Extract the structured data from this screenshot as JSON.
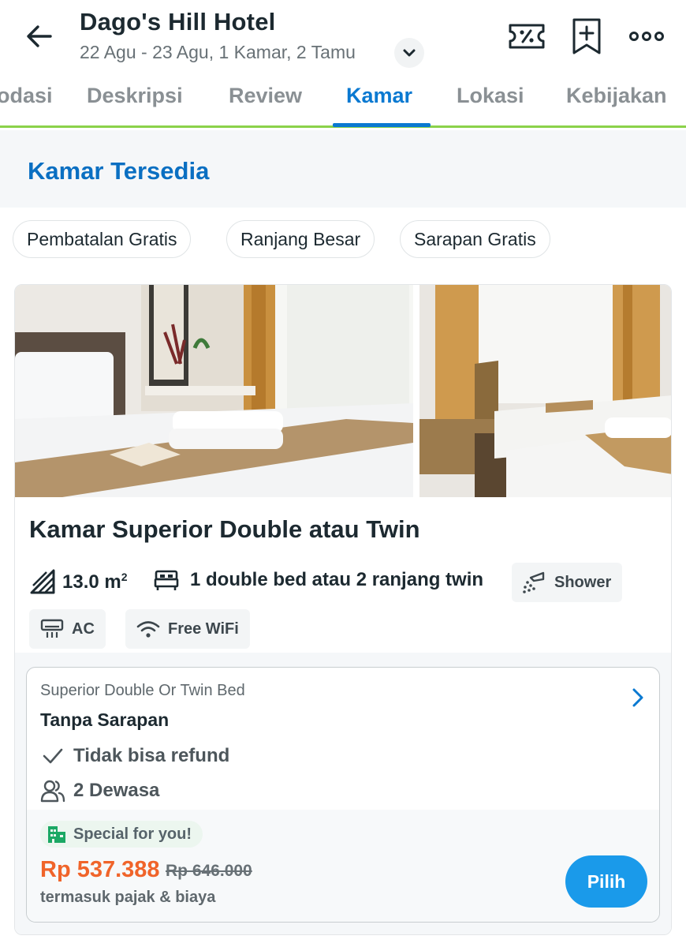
{
  "header": {
    "hotel_name": "Dago's Hill Hotel",
    "booking_summary": "22 Agu - 23 Agu, 1 Kamar, 2 Tamu",
    "icons": [
      "back-arrow-icon",
      "chevron-down-icon",
      "discount-ticket-icon",
      "bookmark-add-icon",
      "more-options-icon"
    ]
  },
  "tabs": [
    {
      "label": "odasi"
    },
    {
      "label": "Deskripsi"
    },
    {
      "label": "Review"
    },
    {
      "label": "Kamar",
      "active": true
    },
    {
      "label": "Lokasi"
    },
    {
      "label": "Kebijakan"
    }
  ],
  "section": {
    "title": "Kamar Tersedia"
  },
  "filters": [
    {
      "label": "Pembatalan Gratis"
    },
    {
      "label": "Ranjang Besar"
    },
    {
      "label": "Sarapan Gratis"
    }
  ],
  "room": {
    "name": "Kamar Superior Double atau Twin",
    "size_value": "13.0 m",
    "size_unit_sup": "2",
    "bed": "1 double bed atau 2 ranjang twin",
    "amenities": [
      {
        "label": "Shower",
        "icon": "shower-icon"
      },
      {
        "label": "AC",
        "icon": "air-conditioner-icon"
      },
      {
        "label": "Free WiFi",
        "icon": "wifi-icon"
      }
    ],
    "rate": {
      "type": "Superior Double Or Twin Bed",
      "name": "Tanpa Sarapan",
      "refund": "Tidak bisa refund",
      "guests": "2 Dewasa",
      "badge": "Special for you!",
      "price": "Rp 537.388",
      "old_price": "Rp 646.000",
      "price_note": "termasuk pajak & biaya",
      "select_label": "Pilih"
    }
  },
  "colors": {
    "brand_blue": "#0a79d1",
    "tab_accent_green": "#8bd24a",
    "price_orange": "#f0642a",
    "button_blue": "#1a9aea",
    "badge_green": "#1ba864"
  }
}
